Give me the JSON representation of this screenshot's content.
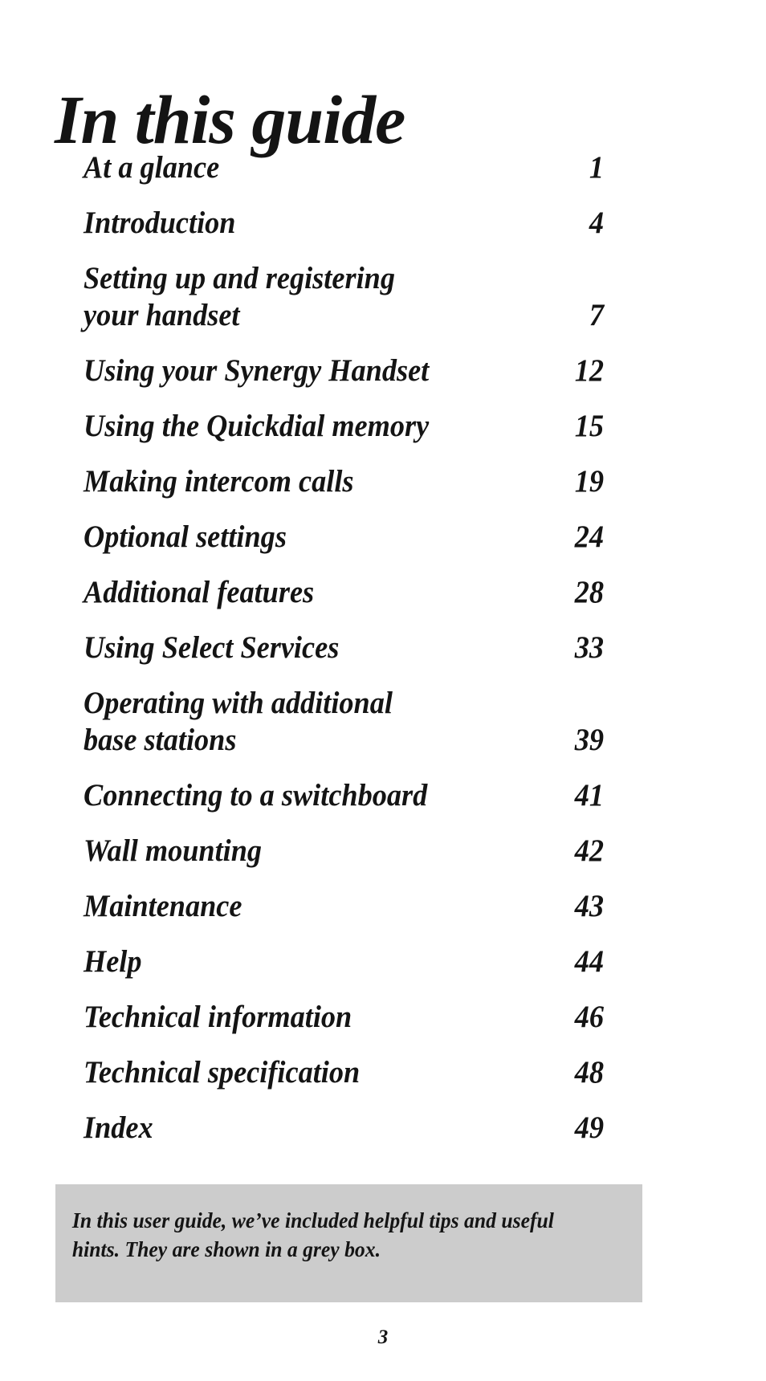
{
  "document": {
    "title": "In this guide",
    "footer_page_number": "3",
    "tip_box": {
      "background_color": "#cccccc",
      "text": "In this user guide, we’ve included helpful tips and useful hints. They are shown in a grey box."
    }
  },
  "toc": {
    "entries": [
      {
        "label": "At a glance",
        "page": "1"
      },
      {
        "label": "Introduction",
        "page": "4"
      },
      {
        "label": "Setting up and registering\nyour handset",
        "page": "7"
      },
      {
        "label": "Using your Synergy Handset",
        "page": "12"
      },
      {
        "label": "Using the Quickdial memory",
        "page": "15"
      },
      {
        "label": "Making intercom calls",
        "page": "19"
      },
      {
        "label": "Optional settings",
        "page": "24"
      },
      {
        "label": "Additional features",
        "page": "28"
      },
      {
        "label": "Using Select Services",
        "page": "33"
      },
      {
        "label": "Operating with additional\nbase stations",
        "page": "39"
      },
      {
        "label": "Connecting to a switchboard",
        "page": "41"
      },
      {
        "label": "Wall mounting",
        "page": "42"
      },
      {
        "label": "Maintenance",
        "page": "43"
      },
      {
        "label": "Help",
        "page": "44"
      },
      {
        "label": "Technical information",
        "page": "46"
      },
      {
        "label": "Technical specification",
        "page": "48"
      },
      {
        "label": "Index",
        "page": "49"
      }
    ]
  }
}
